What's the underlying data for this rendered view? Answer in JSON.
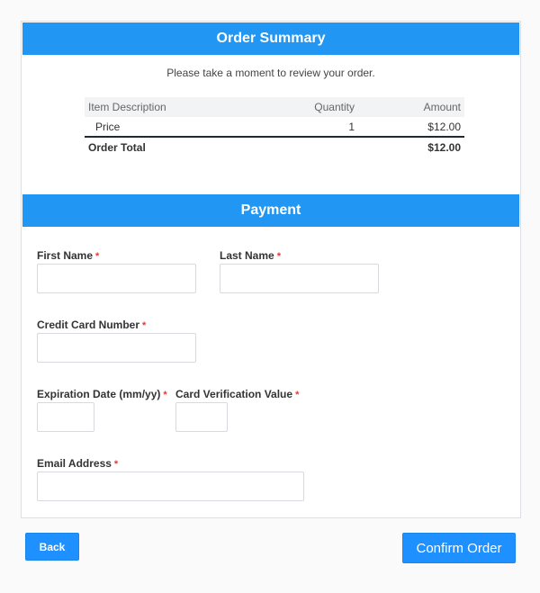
{
  "order_summary": {
    "title": "Order Summary",
    "intro": "Please take a moment to review your order.",
    "columns": {
      "description": "Item Description",
      "quantity": "Quantity",
      "amount": "Amount"
    },
    "items": [
      {
        "description": "Price",
        "quantity": "1",
        "amount": "$12.00"
      }
    ],
    "total": {
      "label": "Order Total",
      "amount": "$12.00"
    }
  },
  "payment": {
    "title": "Payment",
    "required_marker": "*",
    "fields": {
      "first_name": {
        "label": "First Name",
        "value": ""
      },
      "last_name": {
        "label": "Last Name",
        "value": ""
      },
      "card_number": {
        "label": "Credit Card Number",
        "value": ""
      },
      "expiration": {
        "label": "Expiration Date (mm/yy)",
        "value": ""
      },
      "cvv": {
        "label": "Card Verification Value",
        "value": ""
      },
      "email": {
        "label": "Email Address",
        "value": ""
      }
    }
  },
  "actions": {
    "back_label": "Back",
    "confirm_label": "Confirm Order"
  },
  "colors": {
    "accent": "#2196f3",
    "button": "#1e90ff",
    "required": "#e53935"
  }
}
